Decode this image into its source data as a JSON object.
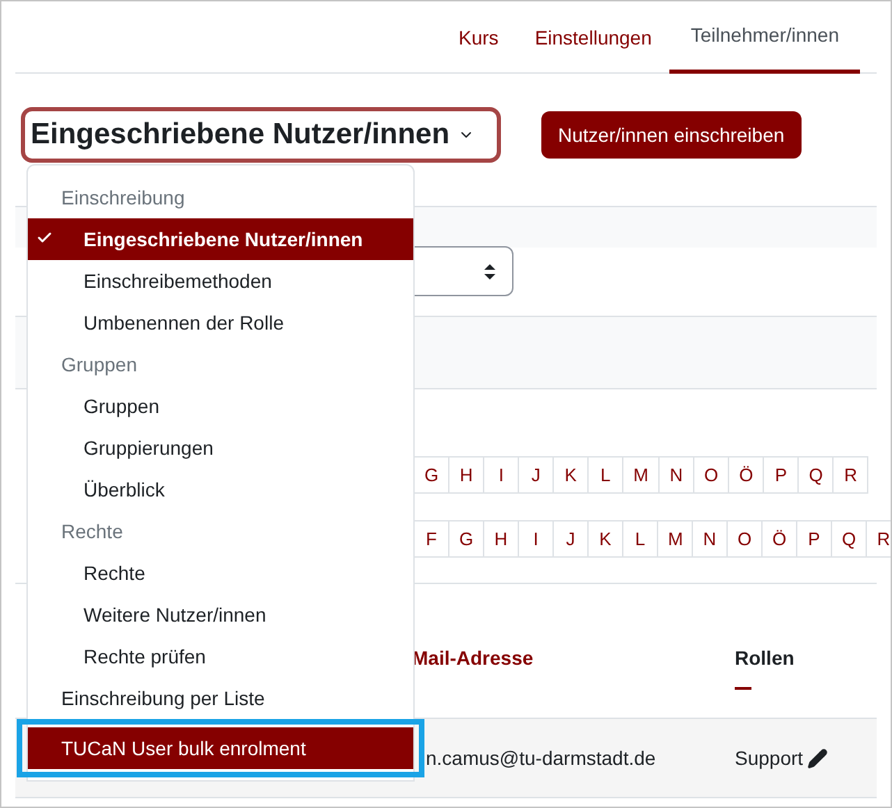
{
  "nav_tabs": [
    {
      "label": "Kurs",
      "selected": false
    },
    {
      "label": "Einstellungen",
      "selected": false
    },
    {
      "label": "Teilnehmer/innen",
      "selected": true
    }
  ],
  "page_select": {
    "value": "Eingeschriebene Nutzer/innen",
    "open": true
  },
  "enrol_button": "Nutzer/innen einschreiben",
  "letter_rows": [
    [
      "G",
      "H",
      "I",
      "J",
      "K",
      "L",
      "M",
      "N",
      "O",
      "Ö",
      "P",
      "Q",
      "R"
    ],
    [
      "F",
      "G",
      "H",
      "I",
      "J",
      "K",
      "L",
      "M",
      "N",
      "O",
      "Ö",
      "P",
      "Q",
      "R"
    ]
  ],
  "table": {
    "columns": [
      {
        "label": "Mail-Adresse",
        "sorted": true
      },
      {
        "label": "Rollen",
        "sorted": false
      }
    ],
    "rows": [
      {
        "email": "n.camus@tu-darmstadt.de",
        "role": "Support"
      }
    ]
  },
  "menu": [
    {
      "kind": "header",
      "label": "Einschreibung"
    },
    {
      "kind": "item",
      "label": "Eingeschriebene Nutzer/innen",
      "selected": true
    },
    {
      "kind": "item",
      "label": "Einschreibemethoden",
      "selected": false
    },
    {
      "kind": "item",
      "label": "Umbenennen der Rolle",
      "selected": false
    },
    {
      "kind": "header",
      "label": "Gruppen"
    },
    {
      "kind": "item",
      "label": "Gruppen",
      "selected": false
    },
    {
      "kind": "item",
      "label": "Gruppierungen",
      "selected": false
    },
    {
      "kind": "item",
      "label": "Überblick",
      "selected": false
    },
    {
      "kind": "header",
      "label": "Rechte"
    },
    {
      "kind": "item",
      "label": "Rechte",
      "selected": false
    },
    {
      "kind": "item",
      "label": "Weitere Nutzer/innen",
      "selected": false
    },
    {
      "kind": "item",
      "label": "Rechte prüfen",
      "selected": false
    },
    {
      "kind": "top",
      "label": "Einschreibung per Liste",
      "selected": false
    },
    {
      "kind": "top",
      "label": "TUCaN User bulk enrolment",
      "selected": false,
      "highlighted": true,
      "annotated": true
    }
  ]
}
